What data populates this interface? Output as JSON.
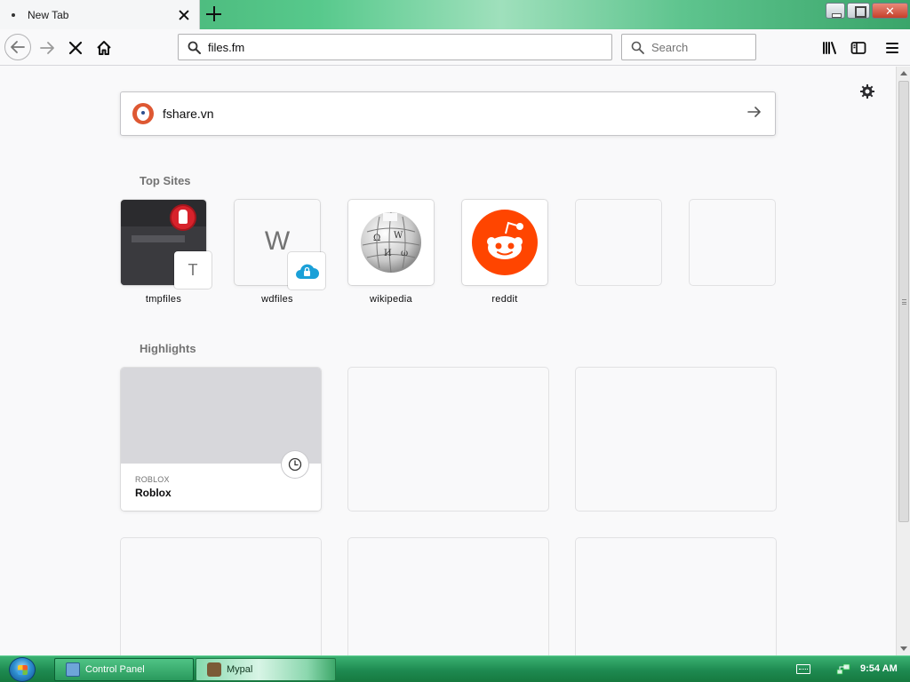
{
  "window": {
    "tab_title": "New Tab"
  },
  "toolbar": {
    "url": "files.fm",
    "search_placeholder": "Search"
  },
  "newtab": {
    "search_query": "fshare.vn",
    "top_sites_title": "Top Sites",
    "highlights_title": "Highlights",
    "top_sites": [
      {
        "label": "tmpfiles",
        "badge": "T"
      },
      {
        "label": "wdfiles",
        "letter": "W"
      },
      {
        "label": "wikipedia"
      },
      {
        "label": "reddit"
      }
    ],
    "highlights": [
      {
        "source": "ROBLOX",
        "title": "Roblox"
      }
    ]
  },
  "taskbar": {
    "items": [
      {
        "label": "Control Panel"
      },
      {
        "label": "Mypal"
      }
    ],
    "clock": "9:54 AM"
  },
  "colors": {
    "accent_tab_green": "#57c98c",
    "reddit_orange": "#ff4500",
    "ddg_orange": "#de5833"
  }
}
